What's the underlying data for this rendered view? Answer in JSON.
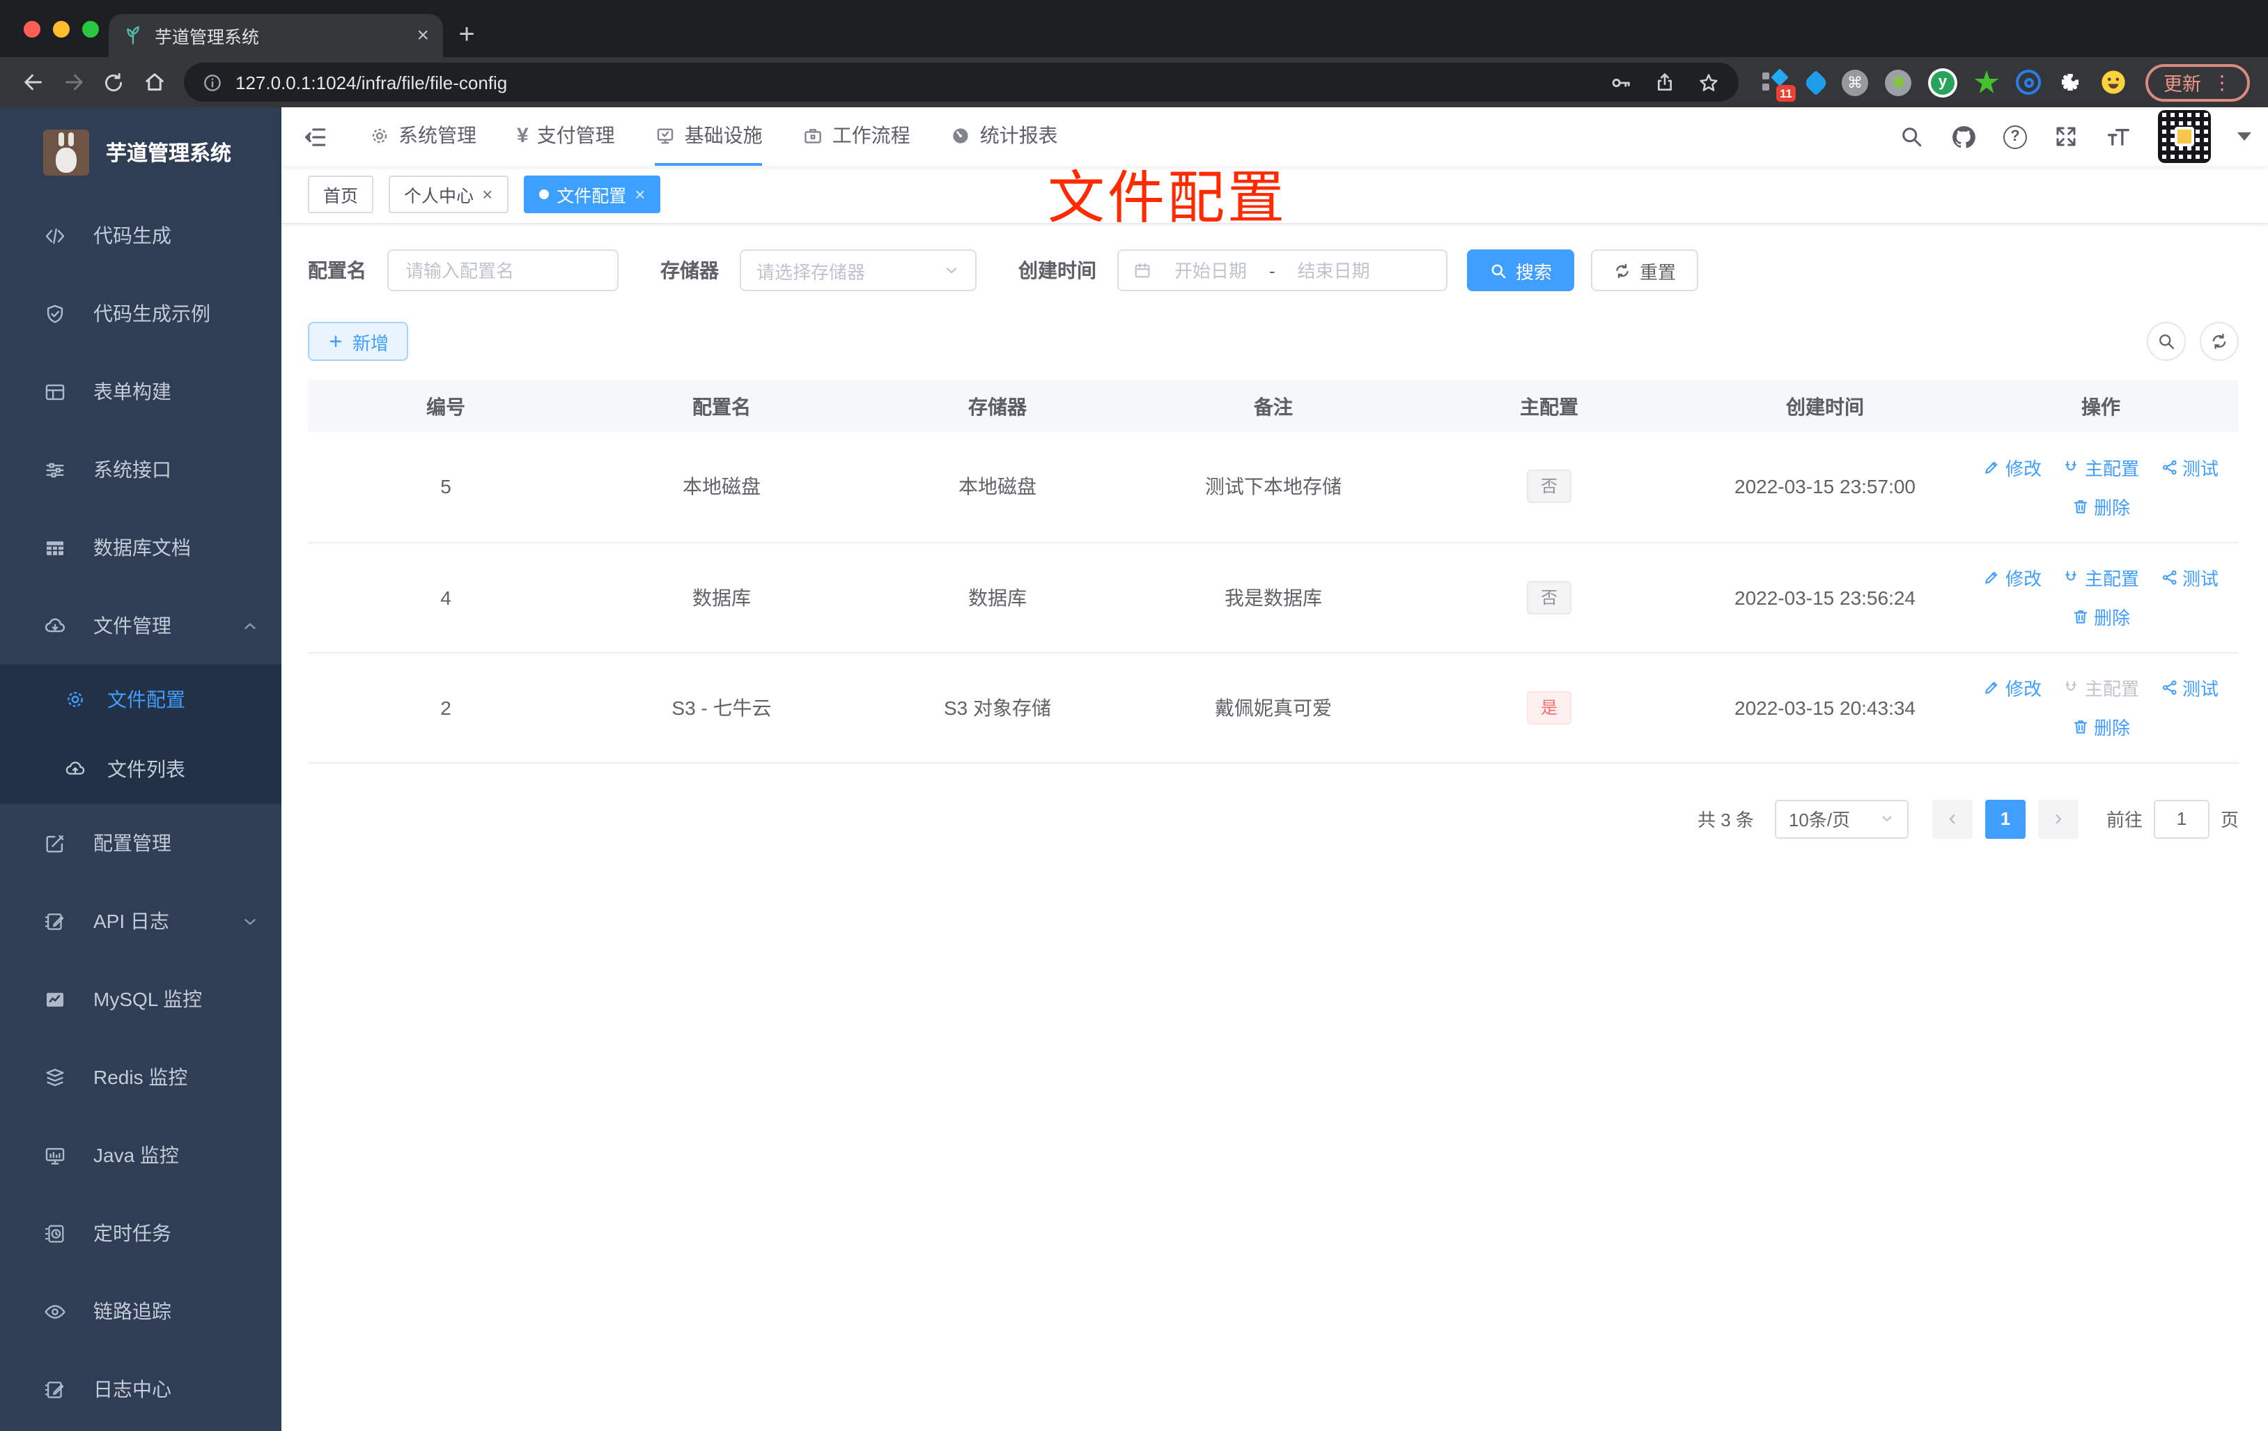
{
  "browser": {
    "tab_title": "芋道管理系统",
    "url": "127.0.0.1:1024/infra/file/file-config",
    "update_label": "更新",
    "ext_badge": "11"
  },
  "icons": {
    "plus": "+",
    "close": "×",
    "yen": "¥",
    "question": "?",
    "command": "⌘",
    "vdots": "⋮",
    "prev": "‹",
    "next": "›",
    "ext_y": "y"
  },
  "sidebar": {
    "logo_title": "芋道管理系统",
    "items": [
      {
        "label": "代码生成"
      },
      {
        "label": "代码生成示例"
      },
      {
        "label": "表单构建"
      },
      {
        "label": "系统接口"
      },
      {
        "label": "数据库文档"
      },
      {
        "label": "文件管理"
      },
      {
        "label": "配置管理"
      },
      {
        "label": "API 日志"
      },
      {
        "label": "MySQL 监控"
      },
      {
        "label": "Redis 监控"
      },
      {
        "label": "Java 监控"
      },
      {
        "label": "定时任务"
      },
      {
        "label": "链路追踪"
      },
      {
        "label": "日志中心"
      }
    ],
    "submenu": [
      {
        "label": "文件配置",
        "active": true
      },
      {
        "label": "文件列表",
        "active": false
      }
    ]
  },
  "topnav": {
    "items": [
      {
        "label": "系统管理"
      },
      {
        "label": "支付管理"
      },
      {
        "label": "基础设施",
        "active": true
      },
      {
        "label": "工作流程"
      },
      {
        "label": "统计报表"
      }
    ]
  },
  "tags": [
    {
      "label": "首页"
    },
    {
      "label": "个人中心",
      "closable": true
    },
    {
      "label": "文件配置",
      "active": true,
      "closable": true
    }
  ],
  "overlay_title": "文件配置",
  "filters": {
    "name_label": "配置名",
    "name_placeholder": "请输入配置名",
    "storage_label": "存储器",
    "storage_placeholder": "请选择存储器",
    "created_label": "创建时间",
    "start_placeholder": "开始日期",
    "separator": "-",
    "end_placeholder": "结束日期",
    "search_label": "搜索",
    "reset_label": "重置"
  },
  "toolbar": {
    "add_label": "新增"
  },
  "table": {
    "headers": [
      "编号",
      "配置名",
      "存储器",
      "备注",
      "主配置",
      "创建时间",
      "操作"
    ],
    "rows": [
      {
        "id": "5",
        "name": "本地磁盘",
        "storage": "本地磁盘",
        "remark": "测试下本地存储",
        "master": "否",
        "created": "2022-03-15 23:57:00"
      },
      {
        "id": "4",
        "name": "数据库",
        "storage": "数据库",
        "remark": "我是数据库",
        "master": "否",
        "created": "2022-03-15 23:56:24"
      },
      {
        "id": "2",
        "name": "S3 - 七牛云",
        "storage": "S3 对象存储",
        "remark": "戴佩妮真可爱",
        "master": "是",
        "created": "2022-03-15 20:43:34"
      }
    ],
    "actions": {
      "edit": "修改",
      "master": "主配置",
      "test": "测试",
      "delete": "删除"
    }
  },
  "pagination": {
    "total_label": "共 3 条",
    "size_label": "10条/页",
    "current_page": "1",
    "goto_label": "前往",
    "goto_value": "1",
    "unit_label": "页"
  },
  "colors": {
    "primary": "#409eff",
    "danger": "#f56c6c",
    "overlay_red": "#ff2a00",
    "sidebar_bg": "#2f3e54",
    "active_tag_bg": "#3da0ff"
  }
}
